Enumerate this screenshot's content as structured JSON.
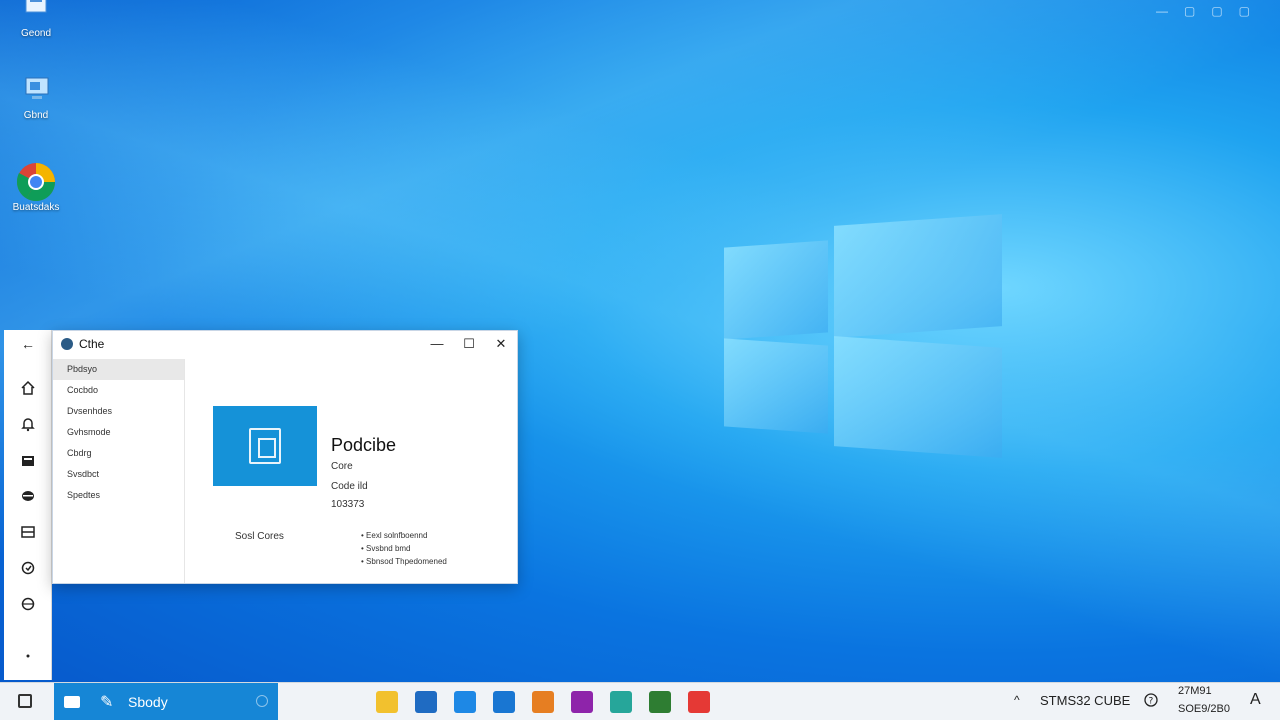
{
  "desktop": {
    "icons": [
      {
        "label": "Geond",
        "icon": "folder-icon"
      },
      {
        "label": "Gbnd",
        "icon": "computer-icon"
      },
      {
        "label": "Buatsdaks",
        "icon": "chrome-icon"
      }
    ]
  },
  "top_controls": [
    "—",
    "▢",
    "▢",
    "▢"
  ],
  "side_rail": {
    "back": "←",
    "items": [
      "home-icon",
      "bell-icon",
      "store-icon",
      "disk-icon",
      "window-icon",
      "shield-icon",
      "globe-icon",
      "dot-icon"
    ]
  },
  "window": {
    "title": "Cthe",
    "controls": {
      "minimize": "—",
      "maximize": "☐",
      "close": "✕"
    },
    "nav": [
      "Pbdsyo",
      "Cocbdo",
      "Dvsenhdes",
      "Gvhsmode",
      "Cbdrg",
      "Svsdbct",
      "Spedtes"
    ],
    "selected_nav": 0,
    "content": {
      "app_name": "Podcibe",
      "line1": "Core",
      "line2": "Code ild",
      "line3": "103373",
      "tile_caption": "Sosl Cores",
      "bullets": [
        "Eexl solnfboennd",
        "Svsbnd bmd",
        "Sbnsod Thpedomened"
      ]
    }
  },
  "taskbar": {
    "search_text": "Sbody",
    "pen_glyph": "✎",
    "apps": [
      {
        "name": "folder-app-icon",
        "color": "#f2c12e"
      },
      {
        "name": "store-app-icon",
        "color": "#1f6bc2"
      },
      {
        "name": "pen-app-icon",
        "color": "#1e88e5"
      },
      {
        "name": "mail-app-icon",
        "color": "#1976d2"
      },
      {
        "name": "people-app-icon",
        "color": "#e67e22"
      },
      {
        "name": "photos-app-icon",
        "color": "#8e24aa"
      },
      {
        "name": "calc-app-icon",
        "color": "#26a69a"
      },
      {
        "name": "books-app-icon",
        "color": "#2e7d32"
      },
      {
        "name": "block-app-icon",
        "color": "#e53935"
      }
    ],
    "tray": {
      "chevron": "^",
      "label": "STMS32 CUBE",
      "clock_time": "27M91",
      "clock_date": "SOE9/2B0",
      "notify": "A"
    }
  }
}
